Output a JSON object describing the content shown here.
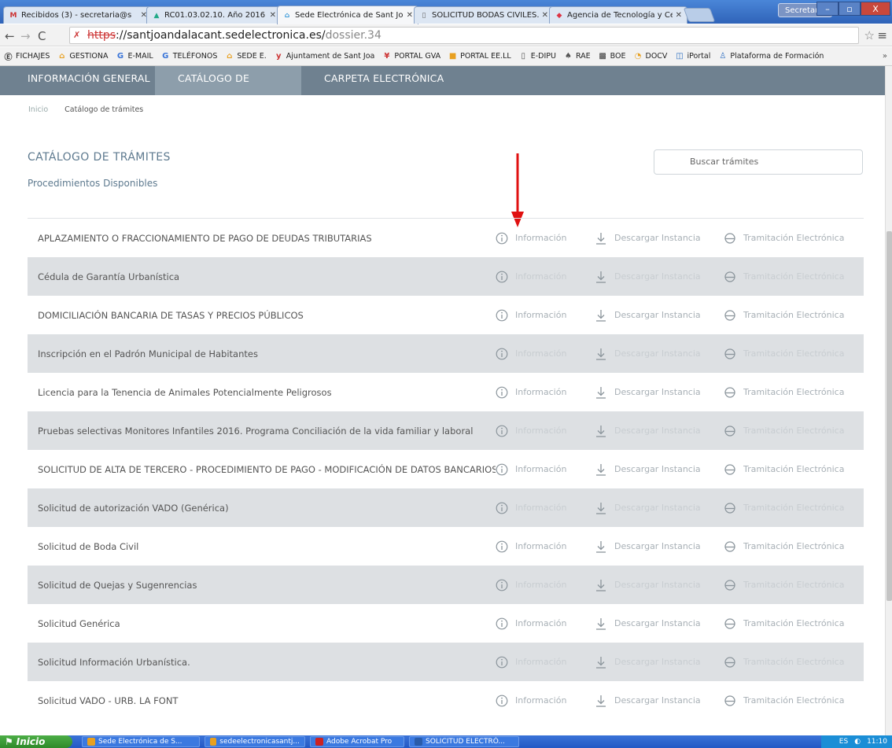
{
  "browser": {
    "tabs": [
      {
        "label": "Recibidos (3) - secretaria@s",
        "icon": "gmail-icon",
        "color": "#c33"
      },
      {
        "label": "RC01.03.02.10. Año 2016 - ",
        "icon": "drive-icon",
        "color": "#2a8"
      },
      {
        "label": "Sede Electrónica de Sant Joa",
        "icon": "building-icon",
        "color": "#3a9ad9"
      },
      {
        "label": "SOLICITUD BODAS CIVILES.",
        "icon": "page-icon",
        "color": "#666"
      },
      {
        "label": "Agencia de Tecnología y Cer",
        "icon": "agency-icon",
        "color": "#d34"
      }
    ],
    "window_user": "Secretaria",
    "window_controls": [
      "–",
      "▫",
      "X"
    ],
    "url_scheme": "https",
    "url_rest": "://santjoandalacant.sedelectronica.es/",
    "url_path": "dossier.34",
    "bookmarks": [
      {
        "label": "FICHAJES",
        "icon": "e-icon"
      },
      {
        "label": "GESTIONA",
        "icon": "building-icon"
      },
      {
        "label": "E-MAIL",
        "icon": "google-icon"
      },
      {
        "label": "TELÉFONOS",
        "icon": "google-icon"
      },
      {
        "label": "SEDE E.",
        "icon": "building-icon"
      },
      {
        "label": "Ajuntament de Sant Joa",
        "icon": "y-icon"
      },
      {
        "label": "PORTAL GVA",
        "icon": "gva-icon"
      },
      {
        "label": "PORTAL EE.LL",
        "icon": "portal-icon"
      },
      {
        "label": "E-DIPU",
        "icon": "page-icon"
      },
      {
        "label": "RAE",
        "icon": "rae-icon"
      },
      {
        "label": "BOE",
        "icon": "boe-icon"
      },
      {
        "label": "DOCV",
        "icon": "docv-icon"
      },
      {
        "label": "iPortal",
        "icon": "iportal-icon"
      },
      {
        "label": "Plataforma de Formación",
        "icon": "formacion-icon"
      }
    ]
  },
  "site": {
    "nav": [
      "INFORMACIÓN GENERAL",
      "CATÁLOGO DE TRÁMITES",
      "CARPETA ELECTRÓNICA"
    ],
    "breadcrumb": {
      "home": "Inicio",
      "current": "Catálogo de trámites"
    },
    "title": "CATÁLOGO DE TRÁMITES",
    "subtitle": "Procedimientos Disponibles",
    "search_placeholder": "Buscar trámites",
    "actions": {
      "info": "Información",
      "download": "Descargar Instancia",
      "electronic": "Tramitación Electrónica"
    },
    "procedures": [
      "APLAZAMIENTO O FRACCIONAMIENTO DE PAGO DE DEUDAS TRIBUTARIAS",
      "Cédula de Garantía Urbanística",
      "DOMICILIACIÓN BANCARIA DE TASAS Y PRECIOS PÚBLICOS",
      "Inscripción en el Padrón Municipal de Habitantes",
      "Licencia para la Tenencia de Animales Potencialmente Peligrosos",
      "Pruebas selectivas Monitores Infantiles 2016. Programa Conciliación de la vida familiar y laboral",
      "SOLICITUD DE ALTA DE TERCERO - PROCEDIMIENTO DE PAGO - MODIFICACIÓN DE DATOS BANCARIOS",
      "Solicitud de autorización VADO (Genérica)",
      "Solicitud de Boda Civil",
      "Solicitud de Quejas y Sugenrencias",
      "Solicitud Genérica",
      "Solicitud Información Urbanística.",
      "Solicitud VADO - URB. LA FONT"
    ],
    "annotation_color": "#e01010"
  },
  "taskbar": {
    "start": "Inicio",
    "items": [
      {
        "label": "Sede Electrónica de S...",
        "color": "#e8a020"
      },
      {
        "label": "sedeelectronicasantj...",
        "color": "#e8a020"
      },
      {
        "label": "Adobe Acrobat Pro",
        "color": "#c22"
      },
      {
        "label": "SOLICITUD ELECTRÓ...",
        "color": "#2a5caa"
      }
    ],
    "lang": "ES",
    "time": "11:10"
  }
}
